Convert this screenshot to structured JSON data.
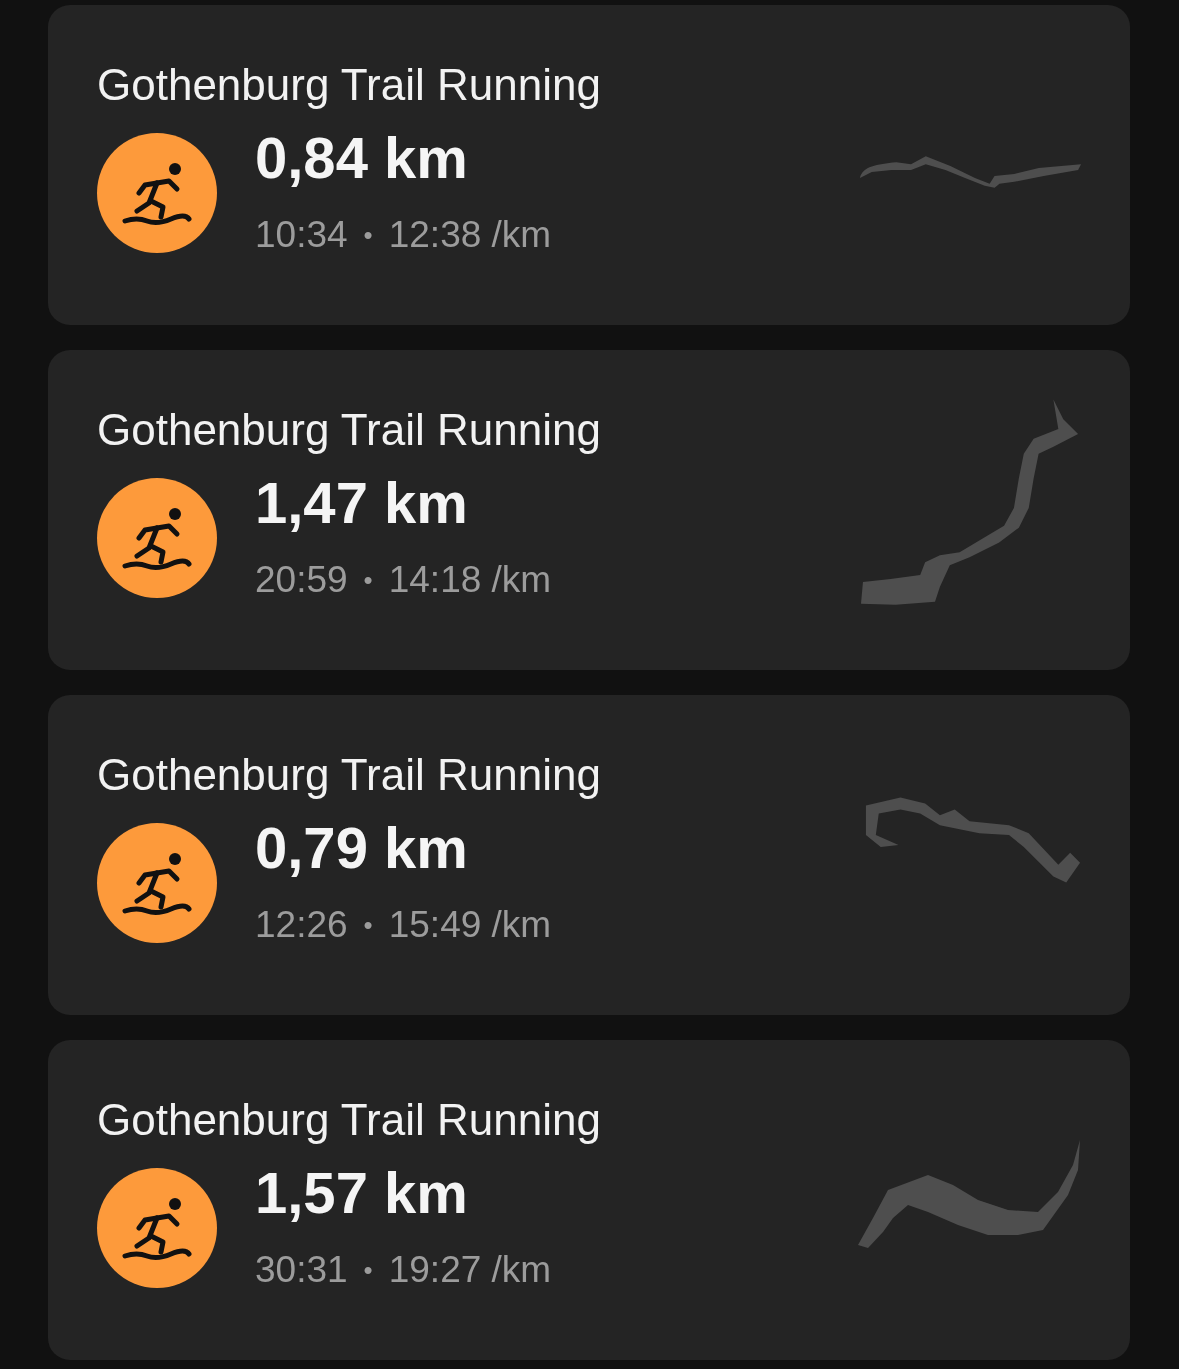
{
  "activities": [
    {
      "title": "Gothenburg Trail Running",
      "distance": "0,84 km",
      "duration": "10:34",
      "separator": "•",
      "pace": "12:38 /km"
    },
    {
      "title": "Gothenburg Trail Running",
      "distance": "1,47 km",
      "duration": "20:59",
      "separator": "•",
      "pace": "14:18 /km"
    },
    {
      "title": "Gothenburg Trail Running",
      "distance": "0,79 km",
      "duration": "12:26",
      "separator": "•",
      "pace": "15:49 /km"
    },
    {
      "title": "Gothenburg Trail Running",
      "distance": "1,57 km",
      "duration": "30:31",
      "separator": "•",
      "pace": "19:27 /km"
    }
  ]
}
